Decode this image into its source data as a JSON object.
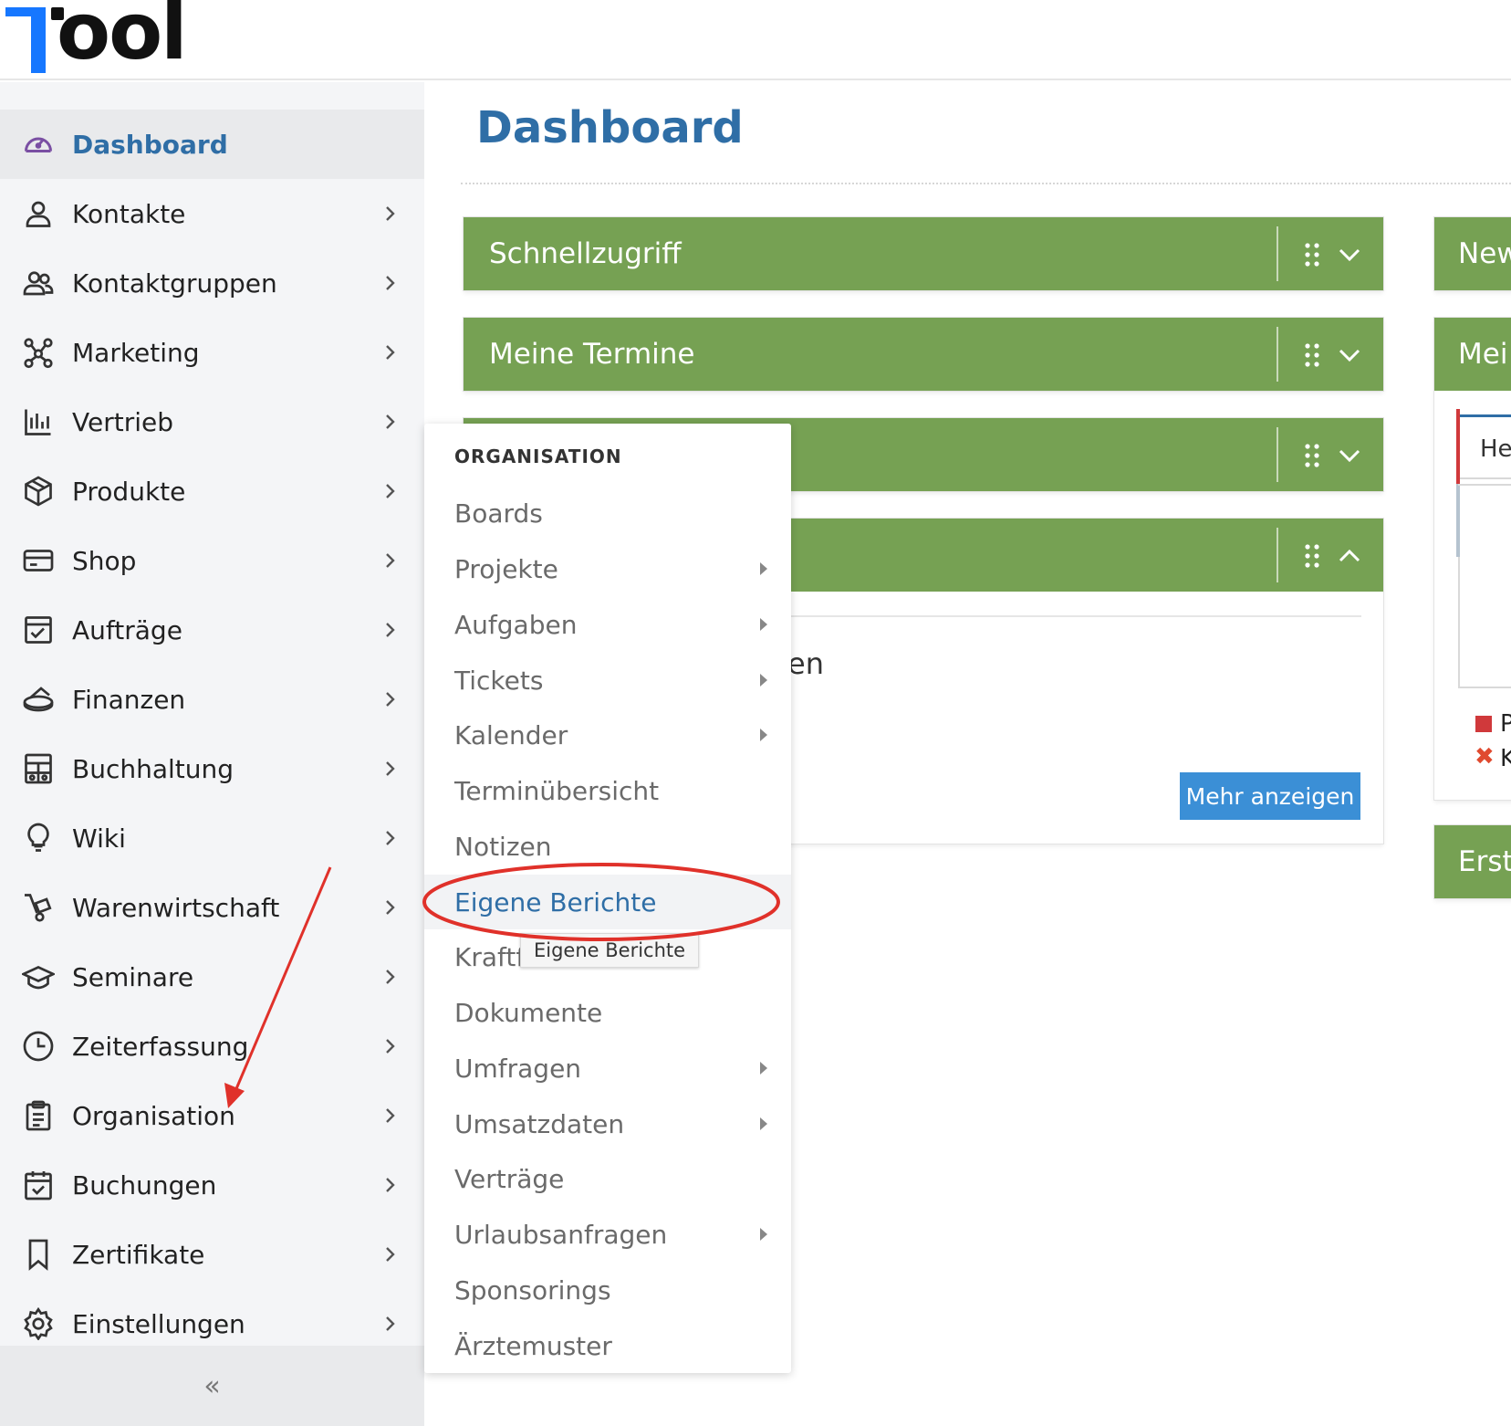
{
  "app": {
    "logo_text": "ool"
  },
  "sidebar": {
    "items": [
      {
        "label": "Dashboard",
        "icon": "dashboard-gauge-icon",
        "active": true
      },
      {
        "label": "Kontakte",
        "icon": "user-icon"
      },
      {
        "label": "Kontaktgruppen",
        "icon": "users-icon"
      },
      {
        "label": "Marketing",
        "icon": "network-icon"
      },
      {
        "label": "Vertrieb",
        "icon": "bar-chart-icon"
      },
      {
        "label": "Produkte",
        "icon": "box-icon"
      },
      {
        "label": "Shop",
        "icon": "credit-card-icon"
      },
      {
        "label": "Aufträge",
        "icon": "clipboard-check-icon"
      },
      {
        "label": "Finanzen",
        "icon": "coins-icon"
      },
      {
        "label": "Buchhaltung",
        "icon": "calculator-icon"
      },
      {
        "label": "Wiki",
        "icon": "lightbulb-icon"
      },
      {
        "label": "Warenwirtschaft",
        "icon": "hand-truck-icon"
      },
      {
        "label": "Seminare",
        "icon": "graduation-cap-icon"
      },
      {
        "label": "Zeiterfassung",
        "icon": "clock-icon"
      },
      {
        "label": "Organisation",
        "icon": "clipboard-list-icon"
      },
      {
        "label": "Buchungen",
        "icon": "calendar-check-icon"
      },
      {
        "label": "Zertifikate",
        "icon": "bookmark-icon"
      },
      {
        "label": "Einstellungen",
        "icon": "gear-icon"
      }
    ],
    "collapse_label": "«"
  },
  "main": {
    "title": "Dashboard",
    "widgets": [
      {
        "title": "Schnellzugriff",
        "expanded": false
      },
      {
        "title": "Meine Termine",
        "expanded": false
      },
      {
        "title": "",
        "expanded": false
      },
      {
        "title": "",
        "expanded": true,
        "empty_text": "en",
        "button": "Mehr anzeigen"
      }
    ],
    "right_widgets": [
      {
        "title": "New"
      },
      {
        "title": "Mei",
        "table_header": "He",
        "legend": [
          {
            "marker": "square",
            "color": "#d0393b",
            "text": "P"
          },
          {
            "marker": "x",
            "color": "#e04a2f",
            "text": "K"
          }
        ]
      },
      {
        "title": "Erst"
      }
    ]
  },
  "flyout": {
    "heading": "ORGANISATION",
    "items": [
      {
        "label": "Boards",
        "submenu": false
      },
      {
        "label": "Projekte",
        "submenu": true
      },
      {
        "label": "Aufgaben",
        "submenu": true
      },
      {
        "label": "Tickets",
        "submenu": true
      },
      {
        "label": "Kalender",
        "submenu": true
      },
      {
        "label": "Terminübersicht",
        "submenu": false
      },
      {
        "label": "Notizen",
        "submenu": false
      },
      {
        "label": "Eigene Berichte",
        "submenu": false,
        "highlighted": true
      },
      {
        "label": "Kraftf",
        "submenu": false
      },
      {
        "label": "Dokumente",
        "submenu": false
      },
      {
        "label": "Umfragen",
        "submenu": true
      },
      {
        "label": "Umsatzdaten",
        "submenu": true
      },
      {
        "label": "Verträge",
        "submenu": false
      },
      {
        "label": "Urlaubsanfragen",
        "submenu": true
      },
      {
        "label": "Sponsorings",
        "submenu": false
      },
      {
        "label": "Ärztemuster",
        "submenu": false
      }
    ],
    "tooltip": "Eigene Berichte"
  },
  "colors": {
    "widget_header": "#76a153",
    "accent_blue": "#2f6ea6",
    "button_blue": "#3b8fd6",
    "annotation_red": "#e0312a"
  }
}
